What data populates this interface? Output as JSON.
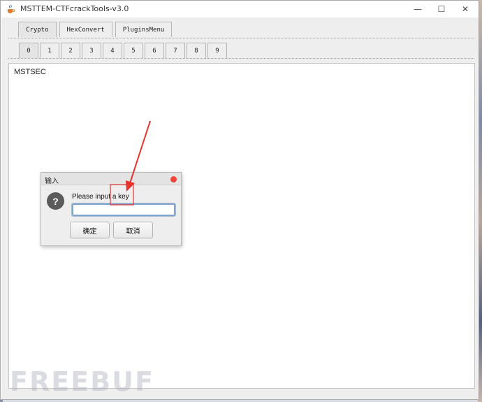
{
  "window": {
    "title": "MSTTEM-CTFcrackTools-v3.0",
    "minimize_glyph": "—",
    "maximize_glyph": "☐",
    "close_glyph": "✕"
  },
  "top_tabs": [
    "Crypto",
    "HexConvert",
    "PluginsMenu"
  ],
  "number_tabs": [
    "0",
    "1",
    "2",
    "3",
    "4",
    "5",
    "6",
    "7",
    "8",
    "9"
  ],
  "panel": {
    "label": "MSTSEC"
  },
  "dialog": {
    "title": "输入",
    "icon_glyph": "?",
    "message": "Please input a key",
    "input_value": "",
    "ok_label": "确定",
    "cancel_label": "取消"
  },
  "watermark": "FREEBUF",
  "colors": {
    "dialog_close": "#f0443b",
    "annotation": "#e8322d",
    "input_focus": "#7fa7d2"
  },
  "icons": {
    "app": "java-cup-icon",
    "dialog_question": "question-icon",
    "dialog_close": "close-dot-icon"
  }
}
